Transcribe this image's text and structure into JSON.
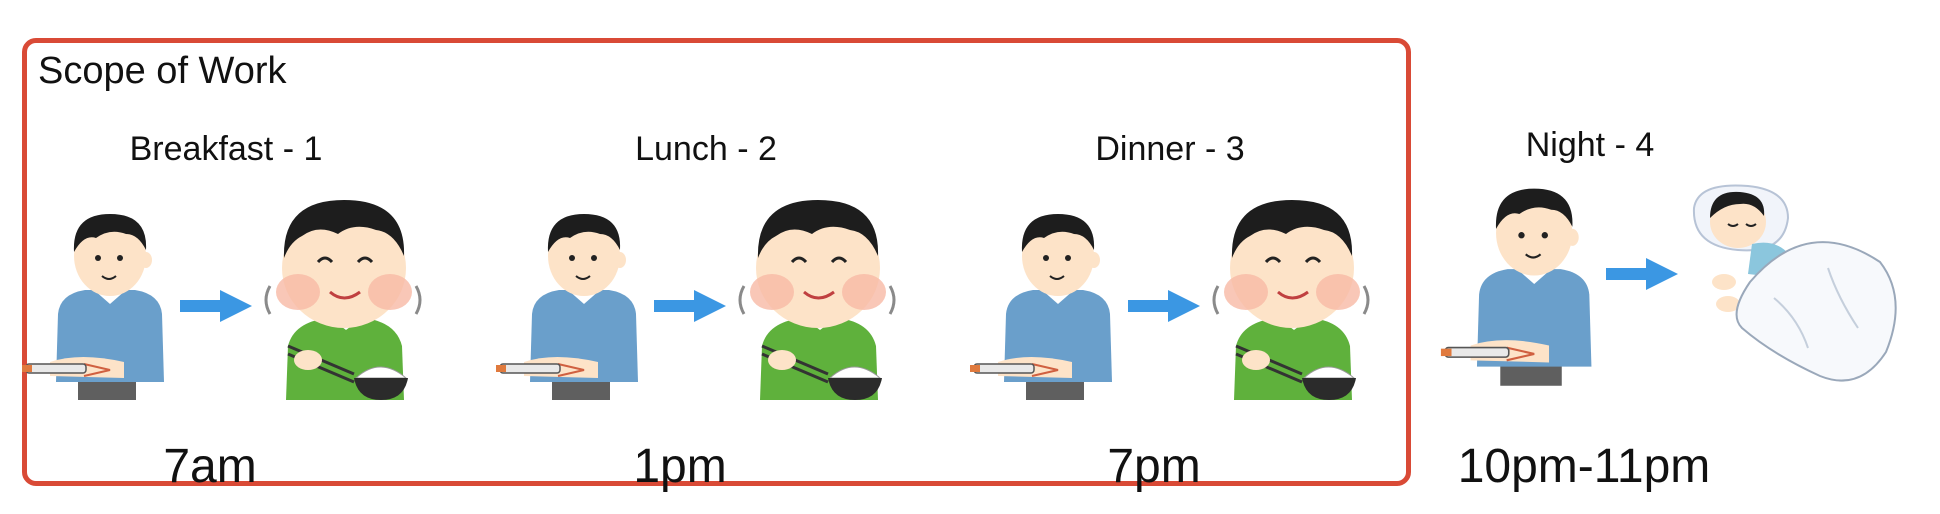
{
  "scope": {
    "title": "Scope of Work"
  },
  "panels": [
    {
      "label": "Breakfast - 1",
      "time": "7am"
    },
    {
      "label": "Lunch - 2",
      "time": "1pm"
    },
    {
      "label": "Dinner - 3",
      "time": "7pm"
    },
    {
      "label": "Night - 4",
      "time": "10pm-11pm"
    }
  ],
  "colors": {
    "border": "#d94a36",
    "arrow": "#3b97e3",
    "shirt_blue": "#6a9fcb",
    "shirt_green": "#5fb13c",
    "skin": "#fde3c8",
    "hair": "#1d1d1d"
  },
  "icons": [
    "insulin-injection-person-icon",
    "arrow-right-icon",
    "eating-person-icon",
    "sleeping-person-icon"
  ]
}
